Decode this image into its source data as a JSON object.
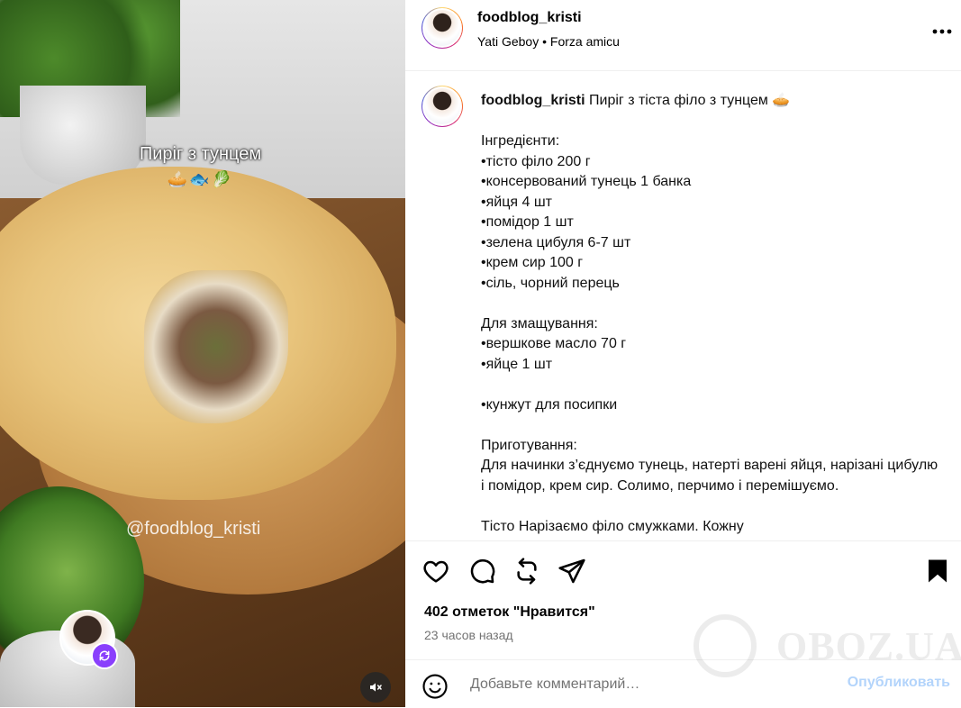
{
  "media": {
    "overlay_title": "Пиріг з тунцем",
    "overlay_emoji": "🥧🐟🥬",
    "watermark_handle": "@foodblog_kristi"
  },
  "header": {
    "username": "foodblog_kristi",
    "audio_artist": "Yati Geboy",
    "audio_separator": "•",
    "audio_track": "Forza amicu",
    "more_icon": "more-horizontal-icon"
  },
  "caption": {
    "username": "foodblog_kristi",
    "lines": [
      "Пиріг з тіста філо з тунцем 🥧",
      "",
      "Інгредієнти:",
      "•тісто філо 200 г",
      "•консервований тунець 1 банка",
      "•яйця 4 шт",
      "•помідор 1 шт",
      "•зелена цибуля 6-7 шт",
      "•крем сир 100 г",
      "•сіль, чорний перець",
      "",
      "Для змащування:",
      "•вершкове масло 70 г",
      "•яйце 1 шт",
      "",
      "•кунжут для посипки",
      "",
      "Приготування:",
      "Для начинки з’єднуємо тунець, натерті варені яйця, нарізані цибулю і помідор, крем сир. Солимо, перчимо і перемішуємо.",
      "",
      "Тісто Нарізаємо філо смужками. Кожну"
    ]
  },
  "actions": {
    "icons": [
      "heart-icon",
      "comment-icon",
      "repost-icon",
      "share-icon",
      "bookmark-icon"
    ]
  },
  "likes_text": "402 отметок \"Нравится\"",
  "time_text": "23 часов назад",
  "comment": {
    "placeholder": "Добавьте комментарий…",
    "value": "",
    "publish_label": "Опубликовать"
  },
  "site_watermark": "OBOZ.UA",
  "colors": {
    "publish_disabled": "#b3d4fb",
    "secondary_text": "#737373",
    "remix_badge": "#8a3ffc"
  }
}
